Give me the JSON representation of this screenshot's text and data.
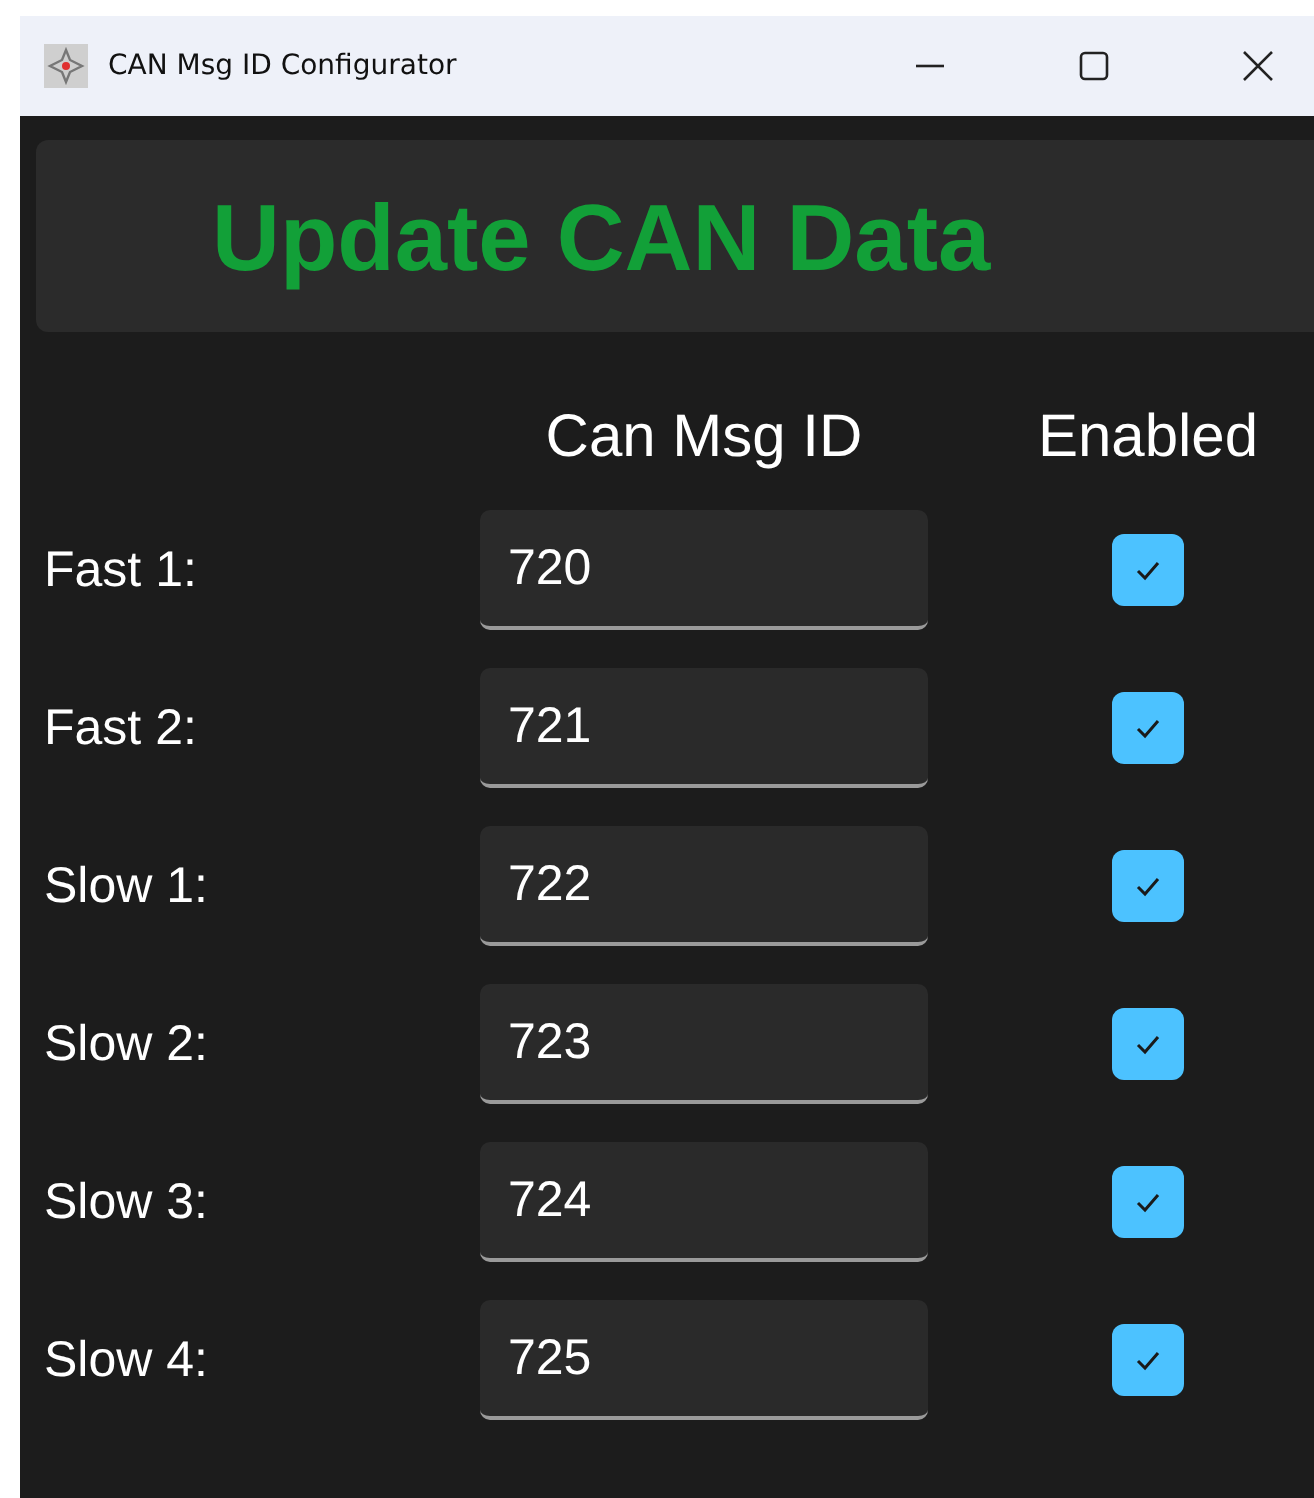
{
  "window": {
    "title": "CAN Msg ID Configurator"
  },
  "update_button": {
    "label": "Update CAN Data"
  },
  "columns": [
    "Can Msg ID",
    "Enabled"
  ],
  "rows": [
    {
      "label": "Fast 1:",
      "value": "720",
      "checked": true
    },
    {
      "label": "Fast 2:",
      "value": "721",
      "checked": true
    },
    {
      "label": "Slow 1:",
      "value": "722",
      "checked": true
    },
    {
      "label": "Slow 2:",
      "value": "723",
      "checked": true
    },
    {
      "label": "Slow 3:",
      "value": "724",
      "checked": true
    },
    {
      "label": "Slow 4:",
      "value": "725",
      "checked": true
    }
  ]
}
